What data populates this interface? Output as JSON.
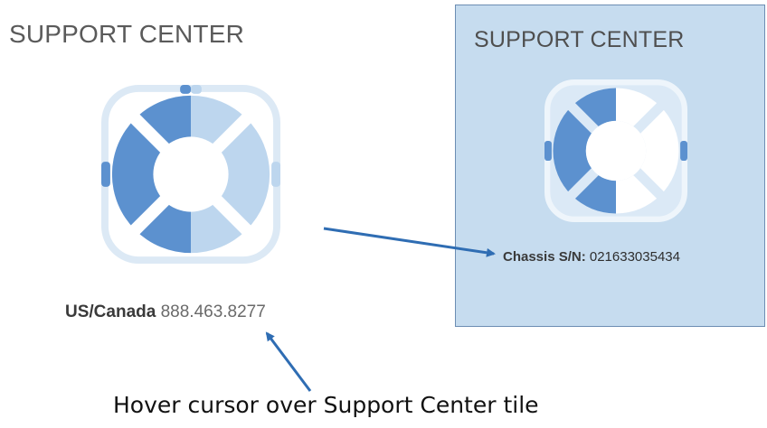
{
  "colors": {
    "buoy_dark": "#5c91cf",
    "buoy_light": "#bdd6ee",
    "buoy_frame": "#dce9f5",
    "tile_bg": "#c6dcef",
    "arrow": "#2f6db3"
  },
  "left_tile": {
    "title": "SUPPORT CENTER",
    "icon": "lifebuoy-icon",
    "phone_label": "US/Canada",
    "phone_number": "888.463.8277"
  },
  "hover_tile": {
    "title": "SUPPORT CENTER",
    "icon": "lifebuoy-icon",
    "chassis_label": "Chassis S/N:",
    "chassis_number": "021633035434"
  },
  "annotation": {
    "caption": "Hover cursor over Support Center tile"
  }
}
